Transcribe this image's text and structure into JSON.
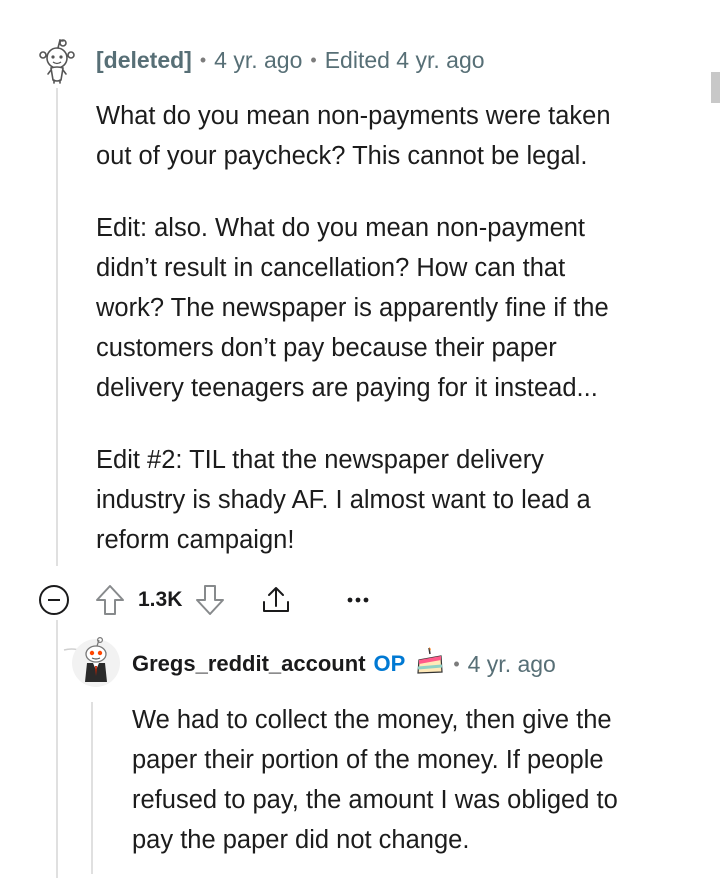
{
  "comment1": {
    "author": "[deleted]",
    "age": "4 yr. ago",
    "edited": "Edited 4 yr. ago",
    "paragraphs": [
      "What do you mean non-payments were taken\nout of your paycheck? This cannot be legal.",
      "Edit: also. What do you mean non-payment\ndidn’t result in cancellation? How can that\nwork? The newspaper is apparently fine if the\ncustomers don’t pay because their paper\ndelivery teenagers are paying for it instead...",
      "Edit #2: TIL that the newspaper delivery\nindustry is shady AF. I almost want to lead a\nreform campaign!"
    ],
    "vote_count": "1.3K"
  },
  "comment2": {
    "author": "Gregs_reddit_account",
    "op_badge": "OP",
    "age": "4 yr. ago",
    "paragraphs": [
      "We had to collect the money, then give the\npaper their portion of the money. If people\nrefused to pay, the amount I was obliged to\npay the paper did not change."
    ]
  },
  "icons": {
    "collapse": "minus-circle-icon",
    "upvote": "upvote-arrow-icon",
    "downvote": "downvote-arrow-icon",
    "share": "share-icon",
    "more": "more-options-icon",
    "flair": "cake-icon"
  },
  "colors": {
    "op": "#0079d3",
    "meta": "#576f76",
    "text": "#1c1c1c",
    "thread_line": "#e0e0e0"
  }
}
